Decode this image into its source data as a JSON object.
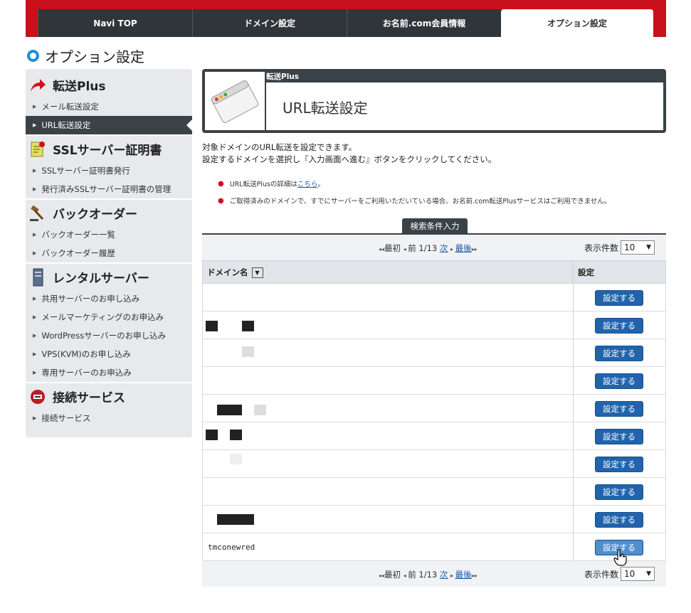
{
  "top_tabs": [
    "Navi TOP",
    "ドメイン設定",
    "お名前.com会員情報",
    "オプション設定"
  ],
  "page_title": "オプション設定",
  "sidebar": {
    "sections": [
      {
        "title": "転送Plus",
        "icon": "arrow-icon",
        "items": [
          "メール転送設定",
          "URL転送設定"
        ]
      },
      {
        "title": "SSLサーバー証明書",
        "icon": "certificate-icon",
        "items": [
          "SSLサーバー証明書発行",
          "発行済みSSLサーバー証明書の管理"
        ]
      },
      {
        "title": "バックオーダー",
        "icon": "gavel-icon",
        "items": [
          "バックオーダー一覧",
          "バックオーダー履歴"
        ]
      },
      {
        "title": "レンタルサーバー",
        "icon": "server-icon",
        "items": [
          "共用サーバーのお申し込み",
          "メールマーケティングのお申込み",
          "WordPressサーバーのお申し込み",
          "VPS(KVM)のお申し込み",
          "専用サーバーのお申込み"
        ]
      },
      {
        "title": "接続サービス",
        "icon": "connection-icon",
        "items": [
          "接続サービス"
        ]
      }
    ],
    "active_item": "URL転送設定"
  },
  "header": {
    "small": "転送Plus",
    "big": "URL転送設定"
  },
  "description": [
    "対象ドメインのURL転送を設定できます。",
    "設定するドメインを選択し『入力画面へ進む』ボタンをクリックしてください。"
  ],
  "notes": {
    "note1_prefix": "URL転送Plusの詳細は",
    "note1_link": "こちら",
    "note1_suffix": "。",
    "note2": "ご取得済みのドメインで、すでにサーバーをご利用いただいている場合、お名前.com転送Plusサービスはご利用できません。"
  },
  "search_tab": "検索条件入力",
  "pager": {
    "first": "最初",
    "prev": "前",
    "page": "1/13",
    "next": "次",
    "last": "最後",
    "per_page_label": "表示件数",
    "per_page_value": "10"
  },
  "table": {
    "col_domain": "ドメイン名",
    "col_setting": "設定",
    "button_label": "設定する",
    "rows": [
      "",
      "",
      "",
      "",
      "",
      "",
      "",
      "",
      "",
      "tmconewred"
    ]
  }
}
